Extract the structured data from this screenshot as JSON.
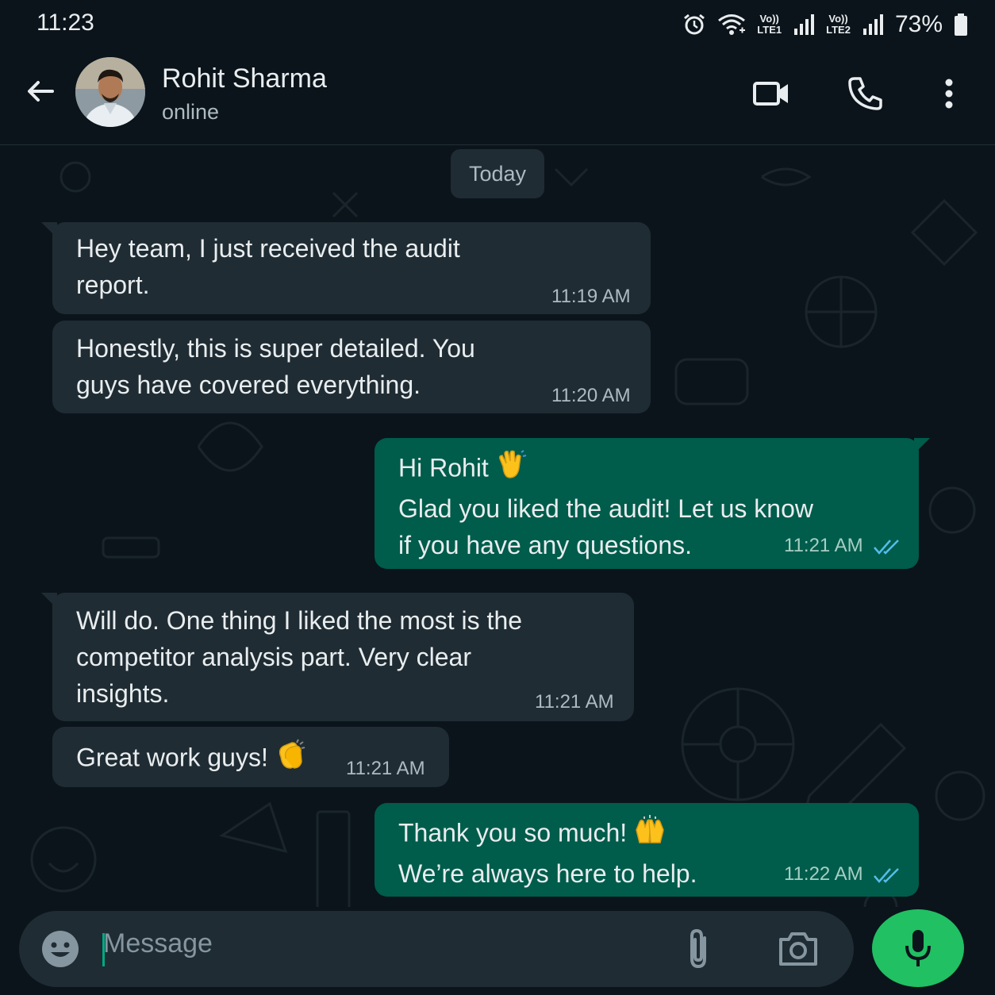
{
  "status_bar": {
    "time": "11:23",
    "sim1_line1": "Vo))",
    "sim1_line2": "LTE1",
    "sim2_line1": "Vo))",
    "sim2_line2": "LTE2",
    "battery": "73%"
  },
  "header": {
    "contact_name": "Rohit Sharma",
    "contact_status": "online",
    "icons": [
      "back-arrow-icon",
      "video-call-icon",
      "voice-call-icon",
      "more-options-icon"
    ]
  },
  "chat": {
    "date_chip": "Today",
    "messages": [
      {
        "direction": "incoming",
        "text": "Hey team, I just received the audit\nreport.",
        "time": "11:19 AM"
      },
      {
        "direction": "incoming",
        "text": "Honestly, this is super detailed. You\nguys have covered everything.",
        "time": "11:20 AM"
      },
      {
        "direction": "outgoing",
        "line1": "Hi Rohit",
        "line2": "Glad you liked the audit! Let us know\nif you have any questions.",
        "emoji": "waving-hand",
        "time": "11:21 AM",
        "read": true
      },
      {
        "direction": "incoming",
        "text": "Will do. One thing I liked the most is the\ncompetitor analysis part. Very clear\ninsights.",
        "time": "11:21 AM"
      },
      {
        "direction": "incoming",
        "text": "Great work guys!",
        "emoji": "clapping-hands",
        "time": "11:21 AM"
      },
      {
        "direction": "outgoing",
        "line1": "Thank you so much!",
        "line2": "We’re always here to help.",
        "emoji": "raising-hands",
        "time": "11:22 AM",
        "read": true
      }
    ]
  },
  "composer": {
    "placeholder": "Message",
    "icons": [
      "emoji-icon",
      "attach-icon",
      "camera-icon",
      "microphone-icon"
    ]
  },
  "colors": {
    "background": "#0b141a",
    "incoming_bubble": "#1f2c33",
    "outgoing_bubble": "#005c4b",
    "accent_green": "#21c063",
    "read_ticks": "#53bdeb"
  }
}
